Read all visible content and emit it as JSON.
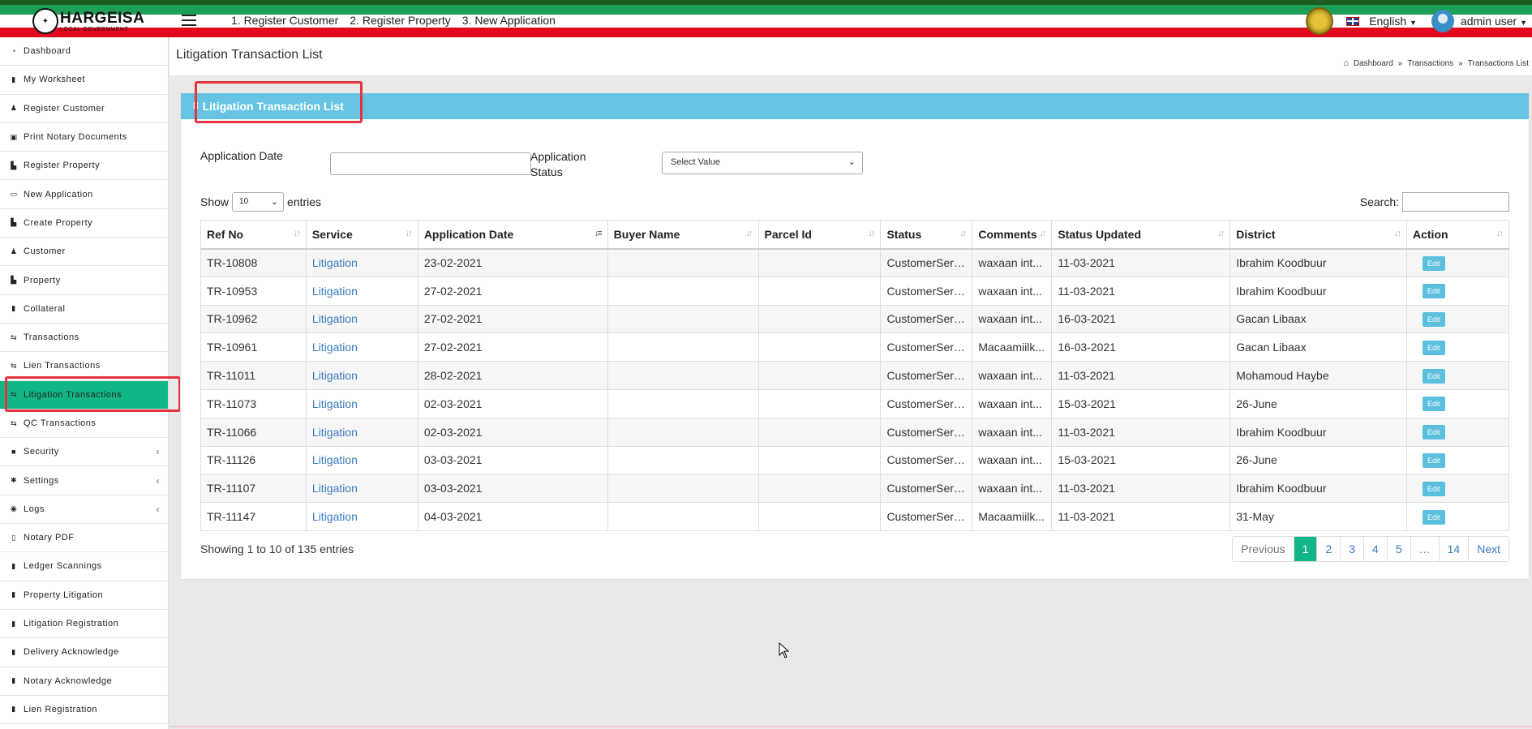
{
  "header": {
    "logo_title": "HARGEISA",
    "logo_subtitle": "LOCAL GOVERNMENT",
    "quick_links": [
      "1. Register Customer",
      "2. Register Property",
      "3. New Application"
    ],
    "language": "English",
    "username": "admin user"
  },
  "sidebar": {
    "items": [
      {
        "label": "Dashboard",
        "icon": "dashboard-icon",
        "glyph": "◔"
      },
      {
        "label": "My Worksheet",
        "icon": "book-icon",
        "glyph": "▮"
      },
      {
        "label": "Register Customer",
        "icon": "user-icon",
        "glyph": "♟"
      },
      {
        "label": "Print Notary Documents",
        "icon": "print-icon",
        "glyph": "▣"
      },
      {
        "label": "Register Property",
        "icon": "building-icon",
        "glyph": "▙"
      },
      {
        "label": "New Application",
        "icon": "monitor-icon",
        "glyph": "▭"
      },
      {
        "label": "Create Property",
        "icon": "building-icon",
        "glyph": "▙"
      },
      {
        "label": "Customer",
        "icon": "user-icon",
        "glyph": "♟"
      },
      {
        "label": "Property",
        "icon": "building-icon",
        "glyph": "▙"
      },
      {
        "label": "Collateral",
        "icon": "book-icon",
        "glyph": "▮"
      },
      {
        "label": "Transactions",
        "icon": "exchange-icon",
        "glyph": "⇆"
      },
      {
        "label": "Lien Transactions",
        "icon": "exchange-icon",
        "glyph": "⇆"
      },
      {
        "label": "Litigation Transactions",
        "icon": "exchange-icon",
        "glyph": "⇆"
      },
      {
        "label": "QC Transactions",
        "icon": "exchange-icon",
        "glyph": "⇆"
      },
      {
        "label": "Security",
        "icon": "lock-icon",
        "glyph": "■",
        "chevron": "‹"
      },
      {
        "label": "Settings",
        "icon": "gear-icon",
        "glyph": "✱",
        "chevron": "‹"
      },
      {
        "label": "Logs",
        "icon": "eye-icon",
        "glyph": "◉",
        "chevron": "‹"
      },
      {
        "label": "Notary PDF",
        "icon": "file-icon",
        "glyph": "▯"
      },
      {
        "label": "Ledger Scannings",
        "icon": "book-icon",
        "glyph": "▮"
      },
      {
        "label": "Property Litigation",
        "icon": "book-icon",
        "glyph": "▮"
      },
      {
        "label": "Litigation Registration",
        "icon": "book-icon",
        "glyph": "▮"
      },
      {
        "label": "Delivery Acknowledge",
        "icon": "book-icon",
        "glyph": "▮"
      },
      {
        "label": "Notary Acknowledge",
        "icon": "book-icon",
        "glyph": "▮"
      },
      {
        "label": "Lien Registration",
        "icon": "book-icon",
        "glyph": "▮"
      }
    ],
    "active_index": 12
  },
  "page": {
    "title": "Litigation Transaction List",
    "breadcrumb": [
      "Dashboard",
      "Transactions",
      "Transactions List"
    ],
    "breadcrumb_sep": "»"
  },
  "card": {
    "title": "Litigation Transaction List"
  },
  "filters": {
    "application_date_label": "Application Date",
    "application_date_value": "",
    "application_status_label_1": "Application",
    "application_status_label_2": "Status",
    "status_selected": "Select Value"
  },
  "table_controls": {
    "show_label": "Show",
    "entries_value": "10",
    "entries_label": "entries",
    "search_label": "Search:",
    "search_value": ""
  },
  "table": {
    "columns": [
      "Ref No",
      "Service",
      "Application Date",
      "Buyer Name",
      "Parcel Id",
      "Status",
      "Comments",
      "Status Updated",
      "District",
      "Action"
    ],
    "rows": [
      [
        "TR-10808",
        "Litigation",
        "23-02-2021",
        "",
        "",
        "CustomerServ...",
        "waxaan int...",
        "11-03-2021",
        "Ibrahim Koodbuur",
        "Edit"
      ],
      [
        "TR-10953",
        "Litigation",
        "27-02-2021",
        "",
        "",
        "CustomerServ...",
        "waxaan int...",
        "11-03-2021",
        "Ibrahim Koodbuur",
        "Edit"
      ],
      [
        "TR-10962",
        "Litigation",
        "27-02-2021",
        "",
        "",
        "CustomerServ...",
        "waxaan int...",
        "16-03-2021",
        "Gacan Libaax",
        "Edit"
      ],
      [
        "TR-10961",
        "Litigation",
        "27-02-2021",
        "",
        "",
        "CustomerServ...",
        "Macaamiilk...",
        "16-03-2021",
        "Gacan Libaax",
        "Edit"
      ],
      [
        "TR-11011",
        "Litigation",
        "28-02-2021",
        "",
        "",
        "CustomerServ...",
        "waxaan int...",
        "11-03-2021",
        "Mohamoud Haybe",
        "Edit"
      ],
      [
        "TR-11073",
        "Litigation",
        "02-03-2021",
        "",
        "",
        "CustomerServ...",
        "waxaan int...",
        "15-03-2021",
        "26-June",
        "Edit"
      ],
      [
        "TR-11066",
        "Litigation",
        "02-03-2021",
        "",
        "",
        "CustomerServ...",
        "waxaan int...",
        "11-03-2021",
        "Ibrahim Koodbuur",
        "Edit"
      ],
      [
        "TR-11126",
        "Litigation",
        "03-03-2021",
        "",
        "",
        "CustomerServ...",
        "waxaan int...",
        "15-03-2021",
        "26-June",
        "Edit"
      ],
      [
        "TR-11107",
        "Litigation",
        "03-03-2021",
        "",
        "",
        "CustomerServ...",
        "waxaan int...",
        "11-03-2021",
        "Ibrahim Koodbuur",
        "Edit"
      ],
      [
        "TR-11147",
        "Litigation",
        "04-03-2021",
        "",
        "",
        "CustomerServ...",
        "Macaamiilk...",
        "11-03-2021",
        "31-May",
        "Edit"
      ]
    ]
  },
  "footer": {
    "info": "Showing 1 to 10 of 135 entries",
    "pagination": [
      "Previous",
      "1",
      "2",
      "3",
      "4",
      "5",
      "…",
      "14",
      "Next"
    ],
    "current_page": "1"
  },
  "colors": {
    "accent_green": "#12b686",
    "card_header_blue": "#66c4e2",
    "highlight_red": "#e53340",
    "link_blue": "#3a7bbf"
  }
}
